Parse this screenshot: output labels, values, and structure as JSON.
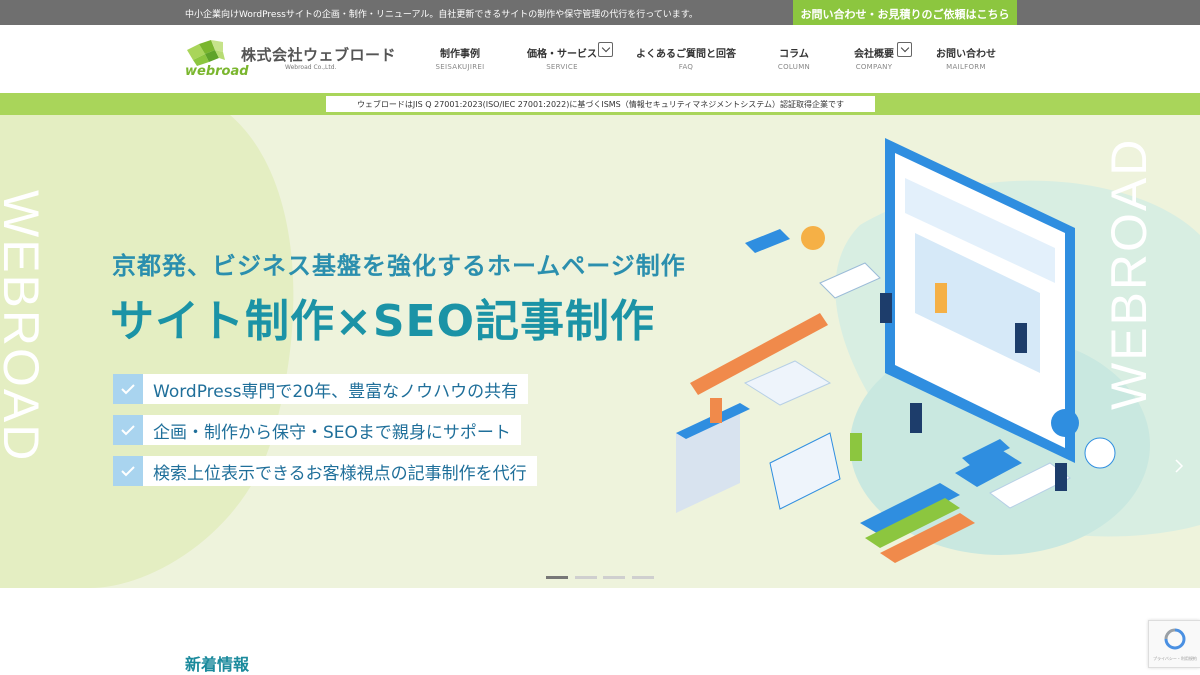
{
  "topbar": {
    "tagline": "中小企業向けWordPressサイトの企画・制作・リニューアル。自社更新できるサイトの制作や保守管理の代行を行っています。",
    "cta": "お問い合わせ・お見積りのご依頼はこちら"
  },
  "logo": {
    "company_jp": "株式会社ウェブロード",
    "company_en": "Webroad Co.,Ltd.",
    "wordmark": "webroad"
  },
  "nav": [
    {
      "jp": "制作事例",
      "en": "SEISAKUJIREI"
    },
    {
      "jp": "価格・サービス",
      "en": "SERVICE"
    },
    {
      "jp": "よくあるご質問と回答",
      "en": "FAQ"
    },
    {
      "jp": "コラム",
      "en": "COLUMN"
    },
    {
      "jp": "会社概要",
      "en": "COMPANY"
    },
    {
      "jp": "お問い合わせ",
      "en": "MAILFORM"
    }
  ],
  "isms": "ウェブロードはJIS Q 27001:2023(ISO/IEC 27001:2022)に基づくISMS（情報セキュリティマネジメントシステム）認証取得企業です",
  "hero": {
    "subtitle": "京都発、ビジネス基盤を強化するホームページ制作",
    "title": "サイト制作×SEO記事制作",
    "features": [
      "WordPress専門で20年、豊富なノウハウの共有",
      "企画・制作から保守・SEOまで親身にサポート",
      "検索上位表示できるお客様視点の記事制作を代行"
    ],
    "side_text": "WEBROAD",
    "slides_total": 4,
    "active_slide": 1
  },
  "news": {
    "title": "新着情報"
  },
  "recaptcha": {
    "text": "プライバシー・利用規約"
  },
  "colors": {
    "accent_green": "#8cc63f",
    "bar_green": "#a9d55a",
    "title_teal": "#1b93a6",
    "check_blue": "#a9d4ef"
  }
}
